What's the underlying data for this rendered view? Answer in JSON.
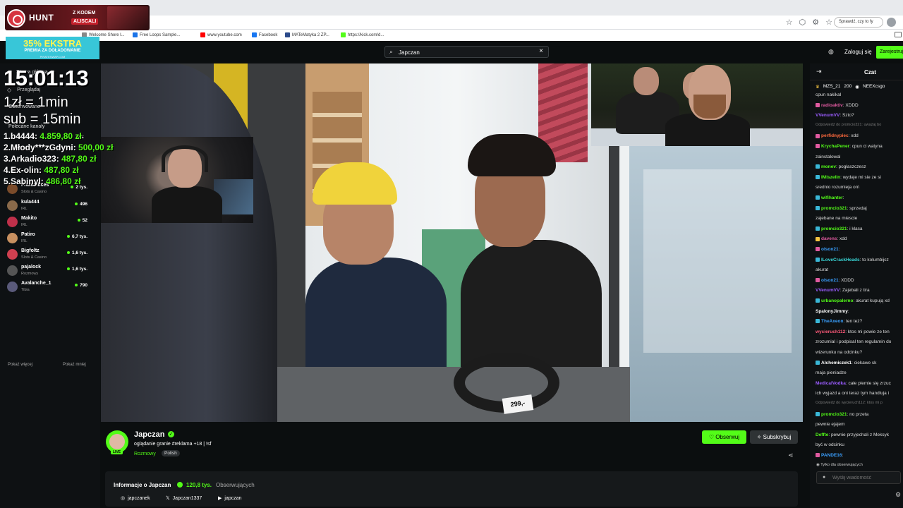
{
  "bookmarks": [
    {
      "label": "Welcome Shore l...",
      "color": "#888888"
    },
    {
      "label": "Free Loops Sample...",
      "color": "#1a73e8"
    },
    {
      "label": "www.youtube.com",
      "color": "#ff0000"
    },
    {
      "label": "Facebook",
      "color": "#1877f2"
    },
    {
      "label": "MATeMatyka 2 ZP...",
      "color": "#2b4a8a"
    },
    {
      "label": "https://kick.com/d...",
      "color": "#53fc18"
    }
  ],
  "browser": {
    "ext_search": "Sprawdź, czy to fy"
  },
  "header": {
    "search_value": "Japczan",
    "login": "Zaloguj się",
    "register": "Zarejestruj"
  },
  "sidebar": {
    "nav": [
      {
        "label": "Strona główna"
      },
      {
        "label": "Przeglądaj"
      }
    ],
    "followed_heading": "Obserwowane",
    "recommended_heading": "Polecane kanały",
    "channels": [
      {
        "name": "Frankbimes",
        "category": "Slots & Casino",
        "viewers": "2 tys.",
        "color": "#7a4b2a"
      },
      {
        "name": "kula444",
        "category": "IRL",
        "viewers": "496",
        "color": "#8a6a4a"
      },
      {
        "name": "Makito",
        "category": "IRL",
        "viewers": "52",
        "color": "#c0304a"
      },
      {
        "name": "Patiro",
        "category": "IRL",
        "viewers": "6,7 tys.",
        "color": "#c89060"
      },
      {
        "name": "Bigfoltz",
        "category": "Slots & Casino",
        "viewers": "1,6 tys.",
        "color": "#d04050"
      },
      {
        "name": "pajalock",
        "category": "Rozmowy",
        "viewers": "1,6 tys.",
        "color": "#555555"
      },
      {
        "name": "Avalanche_1",
        "category": "Tibia",
        "viewers": "790",
        "color": "#5a5a7a"
      }
    ],
    "show_more": "Pokaż więcej",
    "show_less": "Pokaż mniej"
  },
  "overlay": {
    "hunt_brand": "HUNT",
    "hunt_code_label": "Z KODEM",
    "hunt_code": "ALISCALI",
    "promo_big": "35% EKSTRA",
    "promo_small": "PREMIA ZA DOŁADOWANIE",
    "promo_tiny": "PIRATESWAP.COM",
    "timer": "15:01:13",
    "rate_line1": "1zł = 1min",
    "rate_line2": "sub = 15min",
    "live_badge": "LIVE",
    "leaderboard": [
      {
        "rank": "1.",
        "name": "b4444:",
        "amount": "4.859,80 zł"
      },
      {
        "rank": "2.",
        "name": "Młody***zGdyni:",
        "amount": "500,00 zł"
      },
      {
        "rank": "3.",
        "name": "Arkadio323:",
        "amount": "487,80 zł"
      },
      {
        "rank": "4.",
        "name": "Ex-olin:",
        "amount": "487,80 zł"
      },
      {
        "rank": "5.",
        "name": "Sabinyl:",
        "amount": "486,80 zł"
      }
    ]
  },
  "video": {
    "price_tag": "299,-"
  },
  "channel": {
    "name": "Japczan",
    "live": "LIVE",
    "stream_title": "oglądanie granie #reklama +18 | !sf",
    "category": "Rozmowy",
    "tag": "Polish",
    "follow": "Obserwuj",
    "subscribe": "Subskrybuj",
    "about_title": "Informacje o Japczan",
    "followers": "120,8 tys.",
    "followers_label": "Obserwujących",
    "socials": [
      {
        "icon": "instagram-icon",
        "glyph": "◎",
        "label": "japczanek"
      },
      {
        "icon": "x-icon",
        "glyph": "𝕏",
        "label": "Japczan1337"
      },
      {
        "icon": "youtube-icon",
        "glyph": "▶",
        "label": "japczan"
      }
    ]
  },
  "chat": {
    "title": "Czat",
    "pinned": [
      {
        "name": "MZS_21",
        "amount": "200"
      },
      {
        "name": "NEEXcsgo",
        "amount": ""
      }
    ],
    "messages": [
      {
        "user": "",
        "text": "cpun nakikal",
        "color": "#dddddd",
        "badge": ""
      },
      {
        "user": "radioaktiv",
        "text": ": XDDD",
        "color": "#e05aa0",
        "badge": "#e05aa0"
      },
      {
        "user": "VVenumVV",
        "text": ": Szto?",
        "color": "#9b5cff",
        "badge": ""
      },
      {
        "user": "",
        "text": "Odpowiedź do promcio321: uważaj bo",
        "color": "#777777",
        "badge": "",
        "reply": true
      },
      {
        "user": "perfidnypiec",
        "text": ": xdd",
        "color": "#ff6a3d",
        "badge": "#e05aa0"
      },
      {
        "user": "KrychaPener",
        "text": ": cpun ci watyna",
        "color": "#53fc18",
        "badge": "#e05aa0"
      },
      {
        "user": "",
        "text": "zainstalowal",
        "color": "#dddddd",
        "badge": ""
      },
      {
        "user": "monev",
        "text": ": pogłaszczesz",
        "color": "#53fc18",
        "badge": "#3ab8d8"
      },
      {
        "user": "IMiszelin",
        "text": ": wydaje mi sie ze si",
        "color": "#53fc18",
        "badge": "#3ab8d8"
      },
      {
        "user": "",
        "text": "srednio rozumieja on\\",
        "color": "#dddddd",
        "badge": ""
      },
      {
        "user": "wifihanter",
        "text": ":",
        "color": "#53fc18",
        "badge": "#3ab8d8"
      },
      {
        "user": "promcio321",
        "text": ": sprzedaj",
        "color": "#53fc18",
        "badge": "#3ab8d8"
      },
      {
        "user": "",
        "text": "zajebane na miescie",
        "color": "#dddddd",
        "badge": ""
      },
      {
        "user": "promcio321",
        "text": ": i klasa",
        "color": "#53fc18",
        "badge": "#3ab8d8"
      },
      {
        "user": "davens",
        "text": ": xdd",
        "color": "#e05aa0",
        "badge": "#f5c542"
      },
      {
        "user": "olson21",
        "text": ":",
        "color": "#3aa0ff",
        "badge": "#e05aa0"
      },
      {
        "user": "ILoveCrackHeads",
        "text": ": to kolumbijcz",
        "color": "#3ad8d8",
        "badge": "#3ab8d8"
      },
      {
        "user": "",
        "text": "akurat",
        "color": "#dddddd",
        "badge": ""
      },
      {
        "user": "olson21",
        "text": ": XDDD",
        "color": "#3aa0ff",
        "badge": "#e05aa0"
      },
      {
        "user": "VVenumVV",
        "text": ": Zajebali z tira",
        "color": "#9b5cff",
        "badge": ""
      },
      {
        "user": "urbanopalerno",
        "text": ": akurat kupują xd",
        "color": "#53fc18",
        "badge": "#3ab8d8"
      },
      {
        "user": "SpalonyJimmy",
        "text": ":",
        "color": "#ffffff",
        "badge": ""
      },
      {
        "user": "TheAxeon",
        "text": ": ten też?",
        "color": "#3aa0ff",
        "badge": "#3ab8d8"
      },
      {
        "user": "wycieruch112",
        "text": ": ktos mi powie ze ten",
        "color": "#ff5a7a",
        "badge": ""
      },
      {
        "user": "",
        "text": "zrozumial i podpisal ten regulamin do",
        "color": "#dddddd",
        "badge": ""
      },
      {
        "user": "",
        "text": "wizerunku na odcinku?",
        "color": "#dddddd",
        "badge": ""
      },
      {
        "user": "Alchemiczek1",
        "text": ": ciekawe sk",
        "color": "#ffffff",
        "badge": "#3ab8d8"
      },
      {
        "user": "",
        "text": "maja pieniadze",
        "color": "#dddddd",
        "badge": ""
      },
      {
        "user": "MedicalVodka",
        "text": ": całe plemie się zrzuc",
        "color": "#9b5cff",
        "badge": ""
      },
      {
        "user": "",
        "text": "ich wyjazd a oni teraz tym handluja i",
        "color": "#dddddd",
        "badge": ""
      },
      {
        "user": "",
        "text": "Odpowiedź do wycieruch112: ktos mi p",
        "color": "#777777",
        "badge": "",
        "reply": true
      },
      {
        "user": "promcio321",
        "text": ": no przeta",
        "color": "#53fc18",
        "badge": "#3ab8d8"
      },
      {
        "user": "",
        "text": "pewnie ejajem",
        "color": "#dddddd",
        "badge": ""
      },
      {
        "user": "Deffte",
        "text": ": pewnie przyjechali z Meksyk",
        "color": "#53fc18",
        "badge": ""
      },
      {
        "user": "",
        "text": "być w odcinku",
        "color": "#dddddd",
        "badge": ""
      },
      {
        "user": "PANDE16",
        "text": ":",
        "color": "#3aa0ff",
        "badge": "#e05aa0"
      }
    ],
    "followers_only": "Tylko dla obserwujących",
    "input_placeholder": "Wyślij wiadomość"
  }
}
